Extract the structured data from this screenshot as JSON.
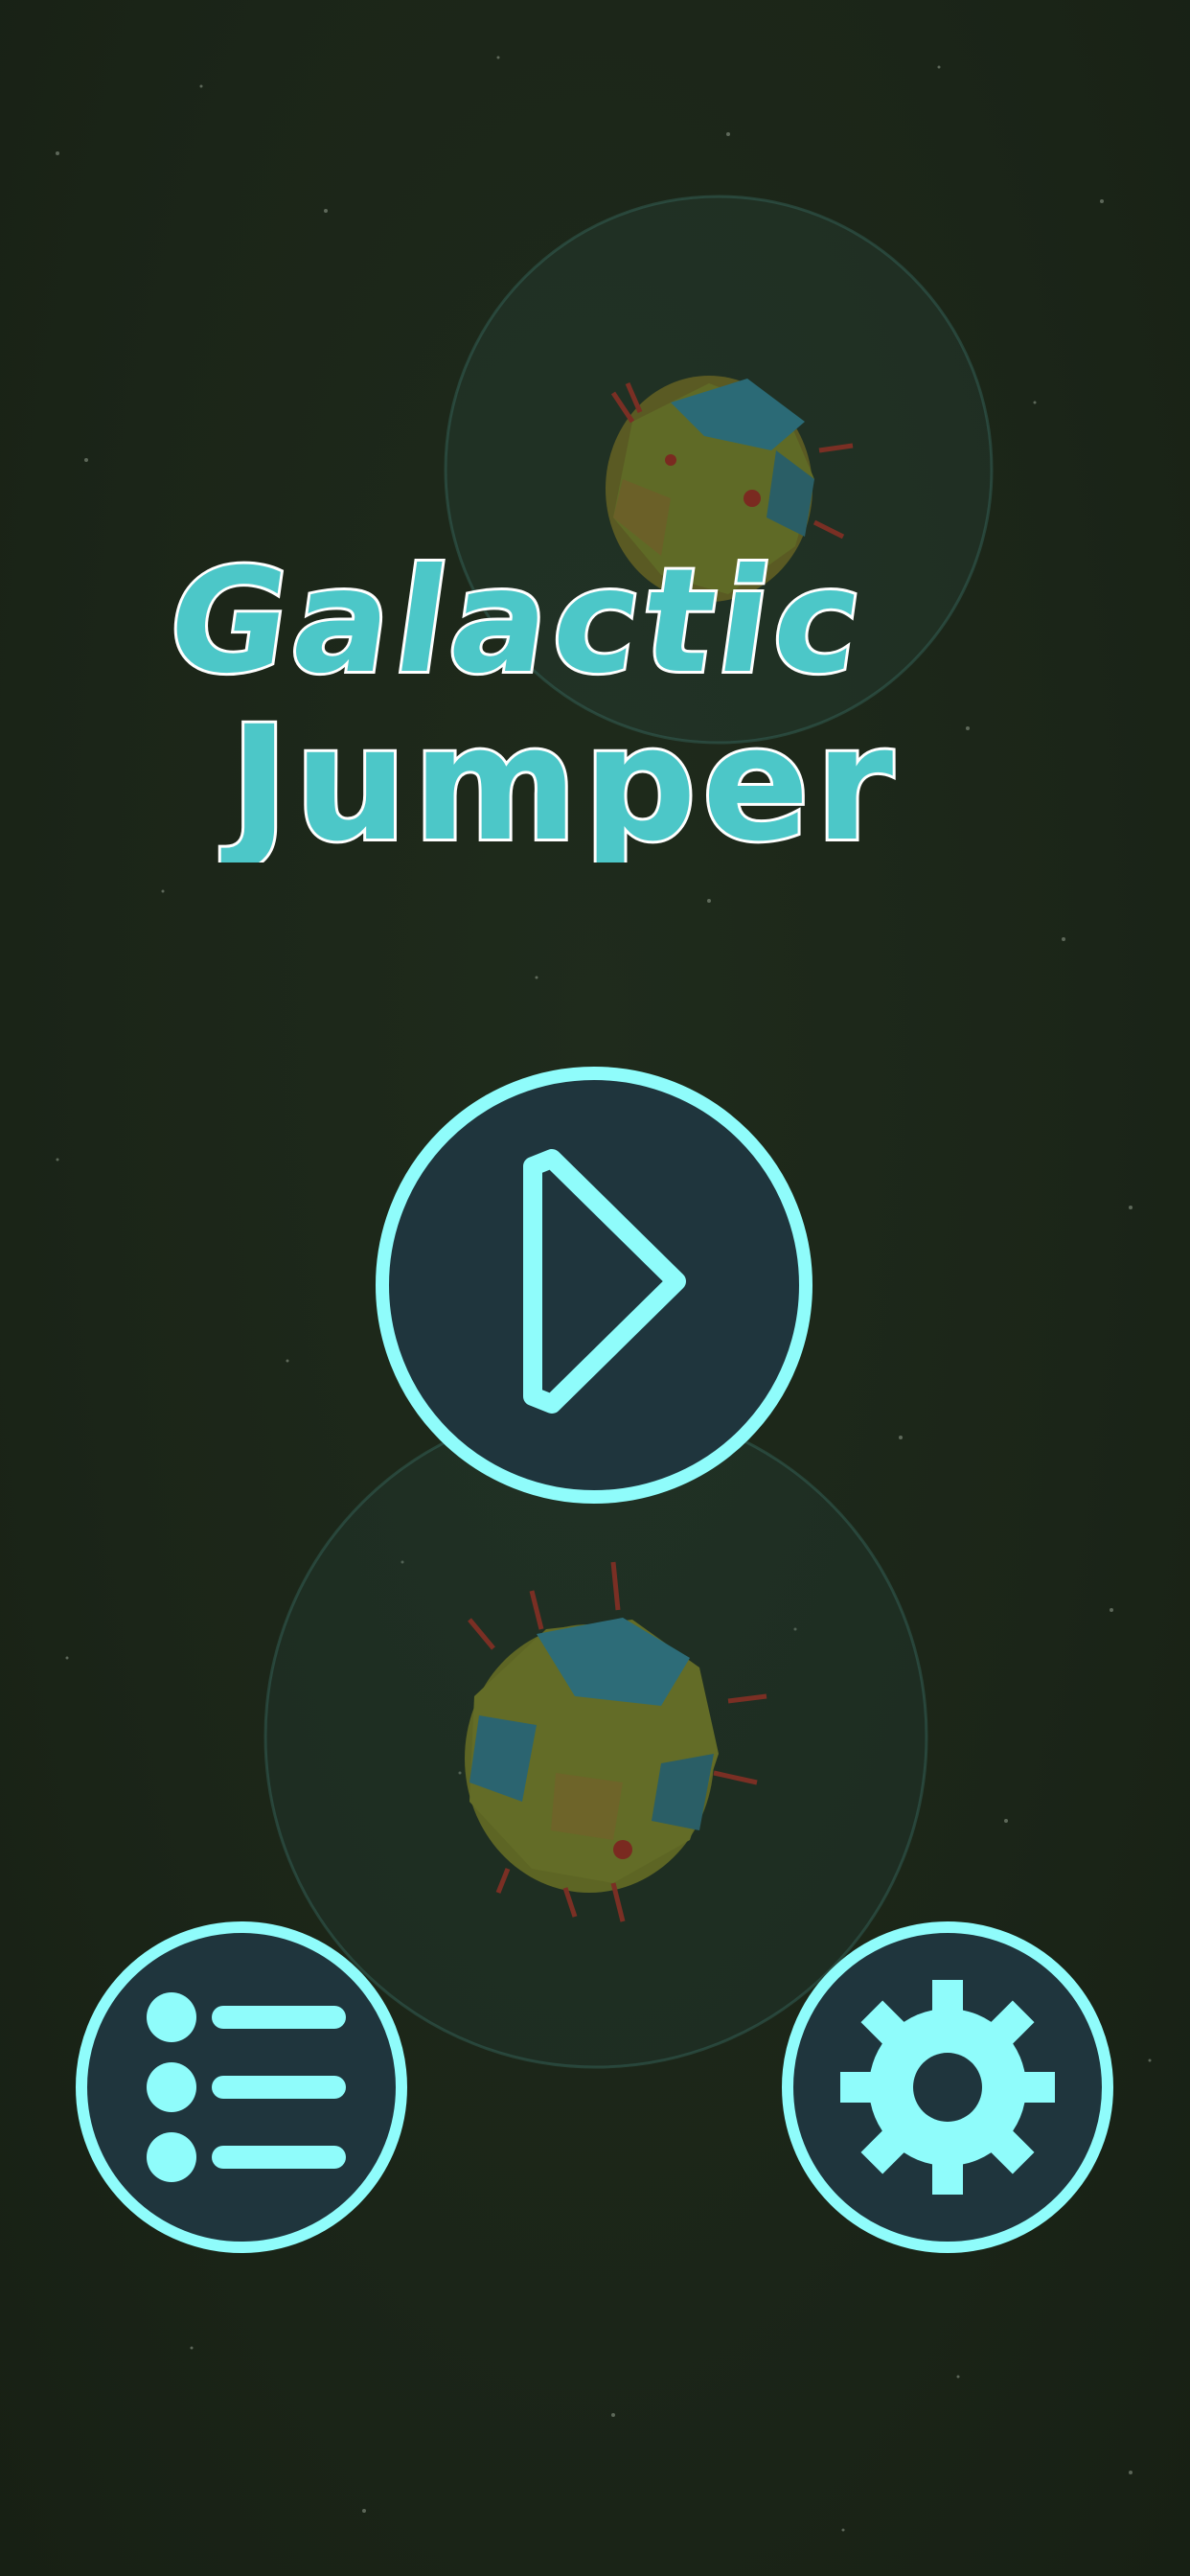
{
  "game": {
    "title_line_1": "Galactic",
    "title_line_2": "Jumper"
  },
  "buttons": {
    "play": {
      "icon": "play-icon"
    },
    "menu": {
      "icon": "list-icon"
    },
    "settings": {
      "icon": "gear-icon"
    }
  },
  "colors": {
    "background": "#1c2719",
    "title_fill": "#4cc7c8",
    "title_outline": "#ffffff",
    "button_fill": "#1f353d",
    "button_accent": "#8ffcfb"
  }
}
